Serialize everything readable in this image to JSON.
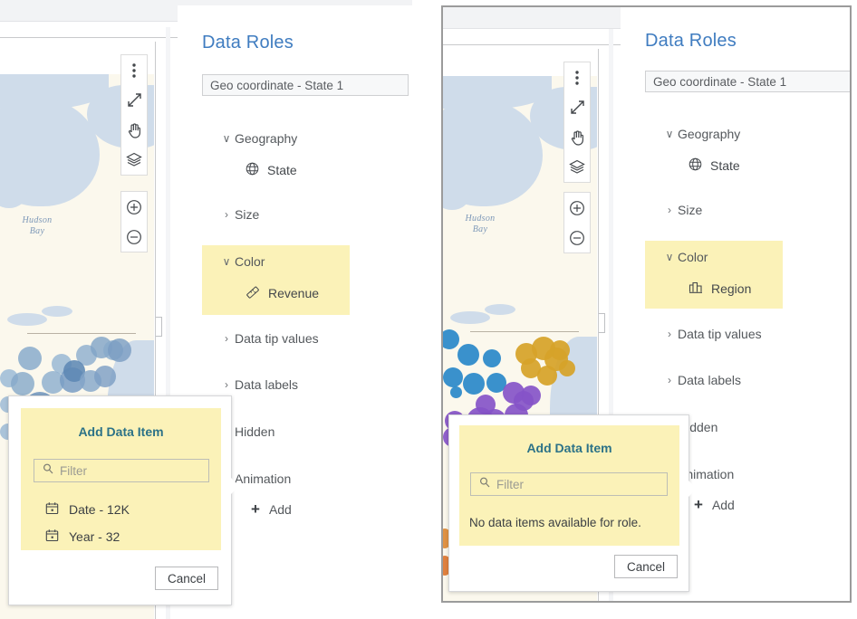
{
  "panels": [
    {
      "id": "left",
      "roles": {
        "title": "Data Roles",
        "geo_field": "Geo coordinate - State 1",
        "sections": [
          {
            "label": "Geography",
            "expanded": true,
            "chevron": "∨",
            "items": [
              {
                "label": "State",
                "icon": "globe-icon"
              }
            ]
          },
          {
            "label": "Size",
            "expanded": false,
            "chevron": "›",
            "items": []
          },
          {
            "label": "Color",
            "expanded": true,
            "chevron": "∨",
            "highlight": true,
            "items": [
              {
                "label": "Revenue",
                "icon": "measure-ruler-icon"
              }
            ]
          },
          {
            "label": "Data tip values",
            "expanded": false,
            "chevron": "›",
            "items": []
          },
          {
            "label": "Data labels",
            "expanded": false,
            "chevron": "›",
            "items": []
          }
        ],
        "hidden_label": "Hidden",
        "animation_label": "Animation",
        "add_label": "Add"
      },
      "popup": {
        "title": "Add Data Item",
        "filter_placeholder": "Filter",
        "filter_value": "",
        "items": [
          {
            "label": "Date - 12K",
            "icon": "calendar-icon"
          },
          {
            "label": "Year - 32",
            "icon": "calendar-icon"
          }
        ],
        "empty_message": "",
        "cancel_label": "Cancel"
      },
      "map": {
        "water_label": "Hudson\nBay"
      }
    },
    {
      "id": "right",
      "roles": {
        "title": "Data Roles",
        "geo_field": "Geo coordinate - State 1",
        "sections": [
          {
            "label": "Geography",
            "expanded": true,
            "chevron": "∨",
            "items": [
              {
                "label": "State",
                "icon": "globe-icon"
              }
            ]
          },
          {
            "label": "Size",
            "expanded": false,
            "chevron": "›",
            "items": []
          },
          {
            "label": "Color",
            "expanded": true,
            "chevron": "∨",
            "highlight": true,
            "items": [
              {
                "label": "Region",
                "icon": "category-bars-icon"
              }
            ]
          },
          {
            "label": "Data tip values",
            "expanded": false,
            "chevron": "›",
            "items": []
          },
          {
            "label": "Data labels",
            "expanded": false,
            "chevron": "›",
            "items": []
          }
        ],
        "hidden_label": "Hidden",
        "animation_label": "Animation",
        "add_label": "Add"
      },
      "popup": {
        "title": "Add Data Item",
        "filter_placeholder": "Filter",
        "filter_value": "",
        "items": [],
        "empty_message": "No data items available for role.",
        "cancel_label": "Cancel"
      },
      "map": {
        "water_label": "Hudson\nBay"
      }
    }
  ],
  "map_toolbar": {
    "buttons": [
      {
        "name": "more-options-icon",
        "title": "More options"
      },
      {
        "name": "expand-arrows-icon",
        "title": "Maximize"
      },
      {
        "name": "pan-hand-icon",
        "title": "Pan"
      },
      {
        "name": "layers-icon",
        "title": "Layers"
      }
    ],
    "zoom_buttons": [
      {
        "name": "zoom-in-icon",
        "title": "Zoom in"
      },
      {
        "name": "zoom-out-icon",
        "title": "Zoom out"
      }
    ]
  },
  "colors": {
    "accent_blue": "#3f7cc0",
    "highlight_yellow": "#fbf2b8",
    "popup_title_teal": "#2c7287",
    "land": "#fbf8ed",
    "water": "#cfdcea",
    "bubble_continuous": "#6b9bc7",
    "bubble_category_blue": "#2f8fd0",
    "bubble_category_gold": "#d9a62b",
    "bubble_category_purple": "#8a63cf"
  }
}
